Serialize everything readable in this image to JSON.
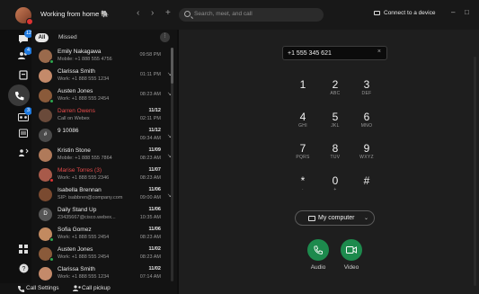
{
  "titlebar": {
    "title": "Working from home 🐘",
    "back_glyph": "‹",
    "forward_glyph": "›",
    "add_glyph": "+",
    "search_placeholder": "Search, meet, and call",
    "connect_label": "Connect to a device",
    "minimize_glyph": "–",
    "maximize_glyph": "□"
  },
  "rail": {
    "messaging_badge": "12",
    "teams_badge": "4",
    "voicemail_badge": "3",
    "icons": [
      "messaging-icon",
      "teams-icon",
      "calendar-app-icon",
      "calling-icon",
      "voicemail-icon",
      "meetings-icon",
      "contacts-icon",
      "settings-icon",
      "apps-icon",
      "help-icon"
    ]
  },
  "filters": {
    "all": "All",
    "missed": "Missed",
    "more": "⋮"
  },
  "calls": [
    {
      "name": "Emily Nakagawa",
      "sub": "Mobile: +1 888 555 4756",
      "date": "",
      "time": "09:58 PM",
      "missed": false,
      "avatar_color": "#9a6a4c",
      "status": "#2fa84f"
    },
    {
      "name": "Clarissa Smith",
      "sub": "Work: +1 888 555 1234",
      "date": "",
      "time": "01:11 PM",
      "missed": false,
      "avatar_color": "#c48a6a",
      "status": ""
    },
    {
      "name": "Austen Jones",
      "sub": "Work: +1 888 555 2454",
      "date": "",
      "time": "08:23 AM",
      "missed": false,
      "avatar_color": "#8a5a3a",
      "status": "#2fa84f"
    },
    {
      "name": "Darren Owens",
      "sub": "Call on Webex",
      "date": "11/12",
      "time": "02:11 PM",
      "missed": true,
      "avatar_color": "#6a4a3a",
      "status": ""
    },
    {
      "name": "9 10086",
      "sub": "",
      "date": "11/12",
      "time": "09:34 AM",
      "missed": false,
      "avatar_color": "#4a4a4a",
      "status": "",
      "initials": "#"
    },
    {
      "name": "Kristin Stone",
      "sub": "Mobile: +1 888 555 7864",
      "date": "11/09",
      "time": "08:23 AM",
      "missed": false,
      "avatar_color": "#b07a5a",
      "status": ""
    },
    {
      "name": "Marise Torres (3)",
      "sub": "Work: +1 888 555 2346",
      "date": "11/07",
      "time": "08:23 AM",
      "missed": true,
      "avatar_color": "#a85a4a",
      "status": "#d33"
    },
    {
      "name": "Isabella Brennan",
      "sub": "SIP: isabbren@company.com",
      "date": "11/06",
      "time": "09:00 AM",
      "missed": false,
      "avatar_color": "#7a4a30",
      "status": ""
    },
    {
      "name": "Daily Stand Up",
      "sub": "23435667@cisco.webex...",
      "date": "11/06",
      "time": "10:35 AM",
      "missed": false,
      "avatar_color": "#555555",
      "status": "",
      "initials": "D"
    },
    {
      "name": "Sofia Gomez",
      "sub": "Work: +1 888 555 2454",
      "date": "11/06",
      "time": "08:23 AM",
      "missed": false,
      "avatar_color": "#c28a60",
      "status": "#2fa84f"
    },
    {
      "name": "Austen Jones",
      "sub": "Work: +1 888 555 2454",
      "date": "11/02",
      "time": "08:23 AM",
      "missed": false,
      "avatar_color": "#8a5a3a",
      "status": "#2fa84f"
    },
    {
      "name": "Clarissa Smith",
      "sub": "Work: +1 888 555 1234",
      "date": "11/02",
      "time": "07:14 AM",
      "missed": false,
      "avatar_color": "#c48a6a",
      "status": ""
    }
  ],
  "footer": {
    "call_settings": "Call Settings",
    "call_pickup": "Call pickup"
  },
  "dialer": {
    "number": "+1 555 345 621",
    "clear_glyph": "×",
    "keys": [
      {
        "d": "1",
        "l": ""
      },
      {
        "d": "2",
        "l": "ABC"
      },
      {
        "d": "3",
        "l": "DEF"
      },
      {
        "d": "4",
        "l": "GHI"
      },
      {
        "d": "5",
        "l": "JKL"
      },
      {
        "d": "6",
        "l": "MNO"
      },
      {
        "d": "7",
        "l": "PQRS"
      },
      {
        "d": "8",
        "l": "TUV"
      },
      {
        "d": "9",
        "l": "WXYZ"
      },
      {
        "d": "*",
        "l": "·"
      },
      {
        "d": "0",
        "l": "+"
      },
      {
        "d": "#",
        "l": ""
      }
    ],
    "device": "My computer",
    "audio_label": "Audio",
    "video_label": "Video"
  },
  "colors": {
    "accent": "#1f7ae0",
    "call_green": "#1d8a4d",
    "missed_red": "#e84b4b"
  }
}
